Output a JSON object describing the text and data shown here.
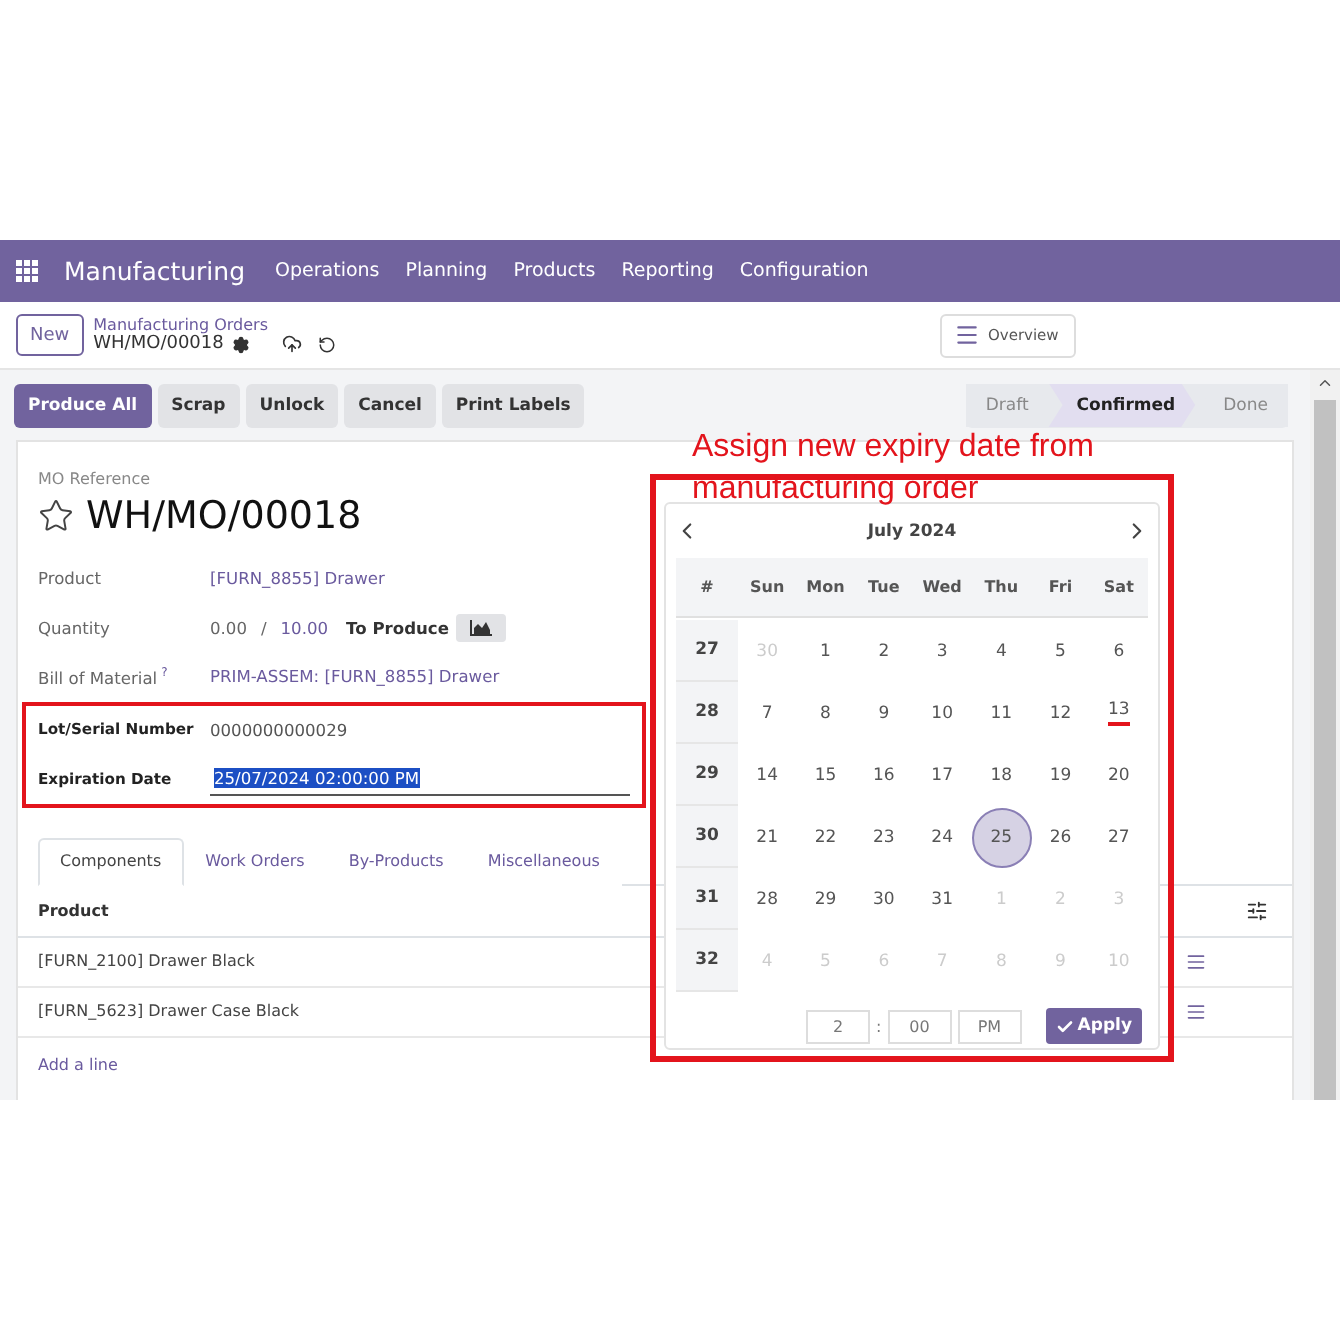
{
  "navbar": {
    "app": "Manufacturing",
    "menu": [
      "Operations",
      "Planning",
      "Products",
      "Reporting",
      "Configuration"
    ]
  },
  "control_panel": {
    "new_button": "New",
    "breadcrumb_parent": "Manufacturing Orders",
    "breadcrumb_current": "WH/MO/00018",
    "overview_button": "Overview"
  },
  "actions": [
    {
      "label": "Produce All",
      "kind": "primary"
    },
    {
      "label": "Scrap",
      "kind": "secondary"
    },
    {
      "label": "Unlock",
      "kind": "secondary"
    },
    {
      "label": "Cancel",
      "kind": "secondary"
    },
    {
      "label": "Print Labels",
      "kind": "secondary"
    }
  ],
  "stages": [
    {
      "label": "Draft",
      "selected": false
    },
    {
      "label": "Confirmed",
      "selected": true
    },
    {
      "label": "Done",
      "selected": false
    }
  ],
  "form": {
    "reference_label": "MO Reference",
    "title": "WH/MO/00018",
    "starred": false,
    "fields": [
      {
        "kind": "link",
        "label": "Product",
        "value": "[FURN_8855] Drawer"
      },
      {
        "kind": "quantity",
        "label": "Quantity",
        "produced": "0.00",
        "separator": "/",
        "planned": "10.00",
        "unit_label": "To Produce"
      },
      {
        "kind": "link",
        "label": "Bill of Material",
        "help": "?",
        "value": "PRIM-ASSEM: [FURN_8855] Drawer"
      },
      {
        "kind": "text",
        "label": "Lot/Serial Number",
        "value": "0000000000029",
        "highlighted": true
      },
      {
        "kind": "input",
        "label": "Expiration Date",
        "value": "25/07/2024 02:00:00 PM",
        "highlighted": true,
        "text_selected": true
      }
    ]
  },
  "tabs": [
    {
      "label": "Components",
      "selected": true
    },
    {
      "label": "Work Orders",
      "selected": false
    },
    {
      "label": "By-Products",
      "selected": false
    },
    {
      "label": "Miscellaneous",
      "selected": false
    }
  ],
  "table": {
    "columns": [
      "Product"
    ],
    "rows": [
      "[FURN_2100] Drawer Black",
      "[FURN_5623] Drawer Case Black"
    ],
    "add_line": "Add a line"
  },
  "calendar": {
    "month": "July 2024",
    "week_header": "#",
    "weekdays": [
      "Sun",
      "Mon",
      "Tue",
      "Wed",
      "Thu",
      "Fri",
      "Sat"
    ],
    "weeks": [
      {
        "number": "27",
        "days": [
          {
            "label": "30",
            "muted": true,
            "selected": false,
            "today": false
          },
          {
            "label": "1",
            "muted": false,
            "selected": false,
            "today": false
          },
          {
            "label": "2",
            "muted": false,
            "selected": false,
            "today": false
          },
          {
            "label": "3",
            "muted": false,
            "selected": false,
            "today": false
          },
          {
            "label": "4",
            "muted": false,
            "selected": false,
            "today": false
          },
          {
            "label": "5",
            "muted": false,
            "selected": false,
            "today": false
          },
          {
            "label": "6",
            "muted": false,
            "selected": false,
            "today": false
          }
        ]
      },
      {
        "number": "28",
        "days": [
          {
            "label": "7",
            "muted": false,
            "selected": false,
            "today": false
          },
          {
            "label": "8",
            "muted": false,
            "selected": false,
            "today": false
          },
          {
            "label": "9",
            "muted": false,
            "selected": false,
            "today": false
          },
          {
            "label": "10",
            "muted": false,
            "selected": false,
            "today": false
          },
          {
            "label": "11",
            "muted": false,
            "selected": false,
            "today": false
          },
          {
            "label": "12",
            "muted": false,
            "selected": false,
            "today": false
          },
          {
            "label": "13",
            "muted": false,
            "selected": false,
            "today": true
          }
        ]
      },
      {
        "number": "29",
        "days": [
          {
            "label": "14",
            "muted": false,
            "selected": false,
            "today": false
          },
          {
            "label": "15",
            "muted": false,
            "selected": false,
            "today": false
          },
          {
            "label": "16",
            "muted": false,
            "selected": false,
            "today": false
          },
          {
            "label": "17",
            "muted": false,
            "selected": false,
            "today": false
          },
          {
            "label": "18",
            "muted": false,
            "selected": false,
            "today": false
          },
          {
            "label": "19",
            "muted": false,
            "selected": false,
            "today": false
          },
          {
            "label": "20",
            "muted": false,
            "selected": false,
            "today": false
          }
        ]
      },
      {
        "number": "30",
        "days": [
          {
            "label": "21",
            "muted": false,
            "selected": false,
            "today": false
          },
          {
            "label": "22",
            "muted": false,
            "selected": false,
            "today": false
          },
          {
            "label": "23",
            "muted": false,
            "selected": false,
            "today": false
          },
          {
            "label": "24",
            "muted": false,
            "selected": false,
            "today": false
          },
          {
            "label": "25",
            "muted": false,
            "selected": true,
            "today": false
          },
          {
            "label": "26",
            "muted": false,
            "selected": false,
            "today": false
          },
          {
            "label": "27",
            "muted": false,
            "selected": false,
            "today": false
          }
        ]
      },
      {
        "number": "31",
        "days": [
          {
            "label": "28",
            "muted": false,
            "selected": false,
            "today": false
          },
          {
            "label": "29",
            "muted": false,
            "selected": false,
            "today": false
          },
          {
            "label": "30",
            "muted": false,
            "selected": false,
            "today": false
          },
          {
            "label": "31",
            "muted": false,
            "selected": false,
            "today": false
          },
          {
            "label": "1",
            "muted": true,
            "selected": false,
            "today": false
          },
          {
            "label": "2",
            "muted": true,
            "selected": false,
            "today": false
          },
          {
            "label": "3",
            "muted": true,
            "selected": false,
            "today": false
          }
        ]
      },
      {
        "number": "32",
        "days": [
          {
            "label": "4",
            "muted": true,
            "selected": false,
            "today": false
          },
          {
            "label": "5",
            "muted": true,
            "selected": false,
            "today": false
          },
          {
            "label": "6",
            "muted": true,
            "selected": false,
            "today": false
          },
          {
            "label": "7",
            "muted": true,
            "selected": false,
            "today": false
          },
          {
            "label": "8",
            "muted": true,
            "selected": false,
            "today": false
          },
          {
            "label": "9",
            "muted": true,
            "selected": false,
            "today": false
          },
          {
            "label": "10",
            "muted": true,
            "selected": false,
            "today": false
          }
        ]
      }
    ],
    "hour": "2",
    "time_separator": ":",
    "minute": "00",
    "meridiem": "PM",
    "apply": "Apply"
  },
  "annotation": {
    "text": "Assign new expiry date from manufacturing order"
  }
}
